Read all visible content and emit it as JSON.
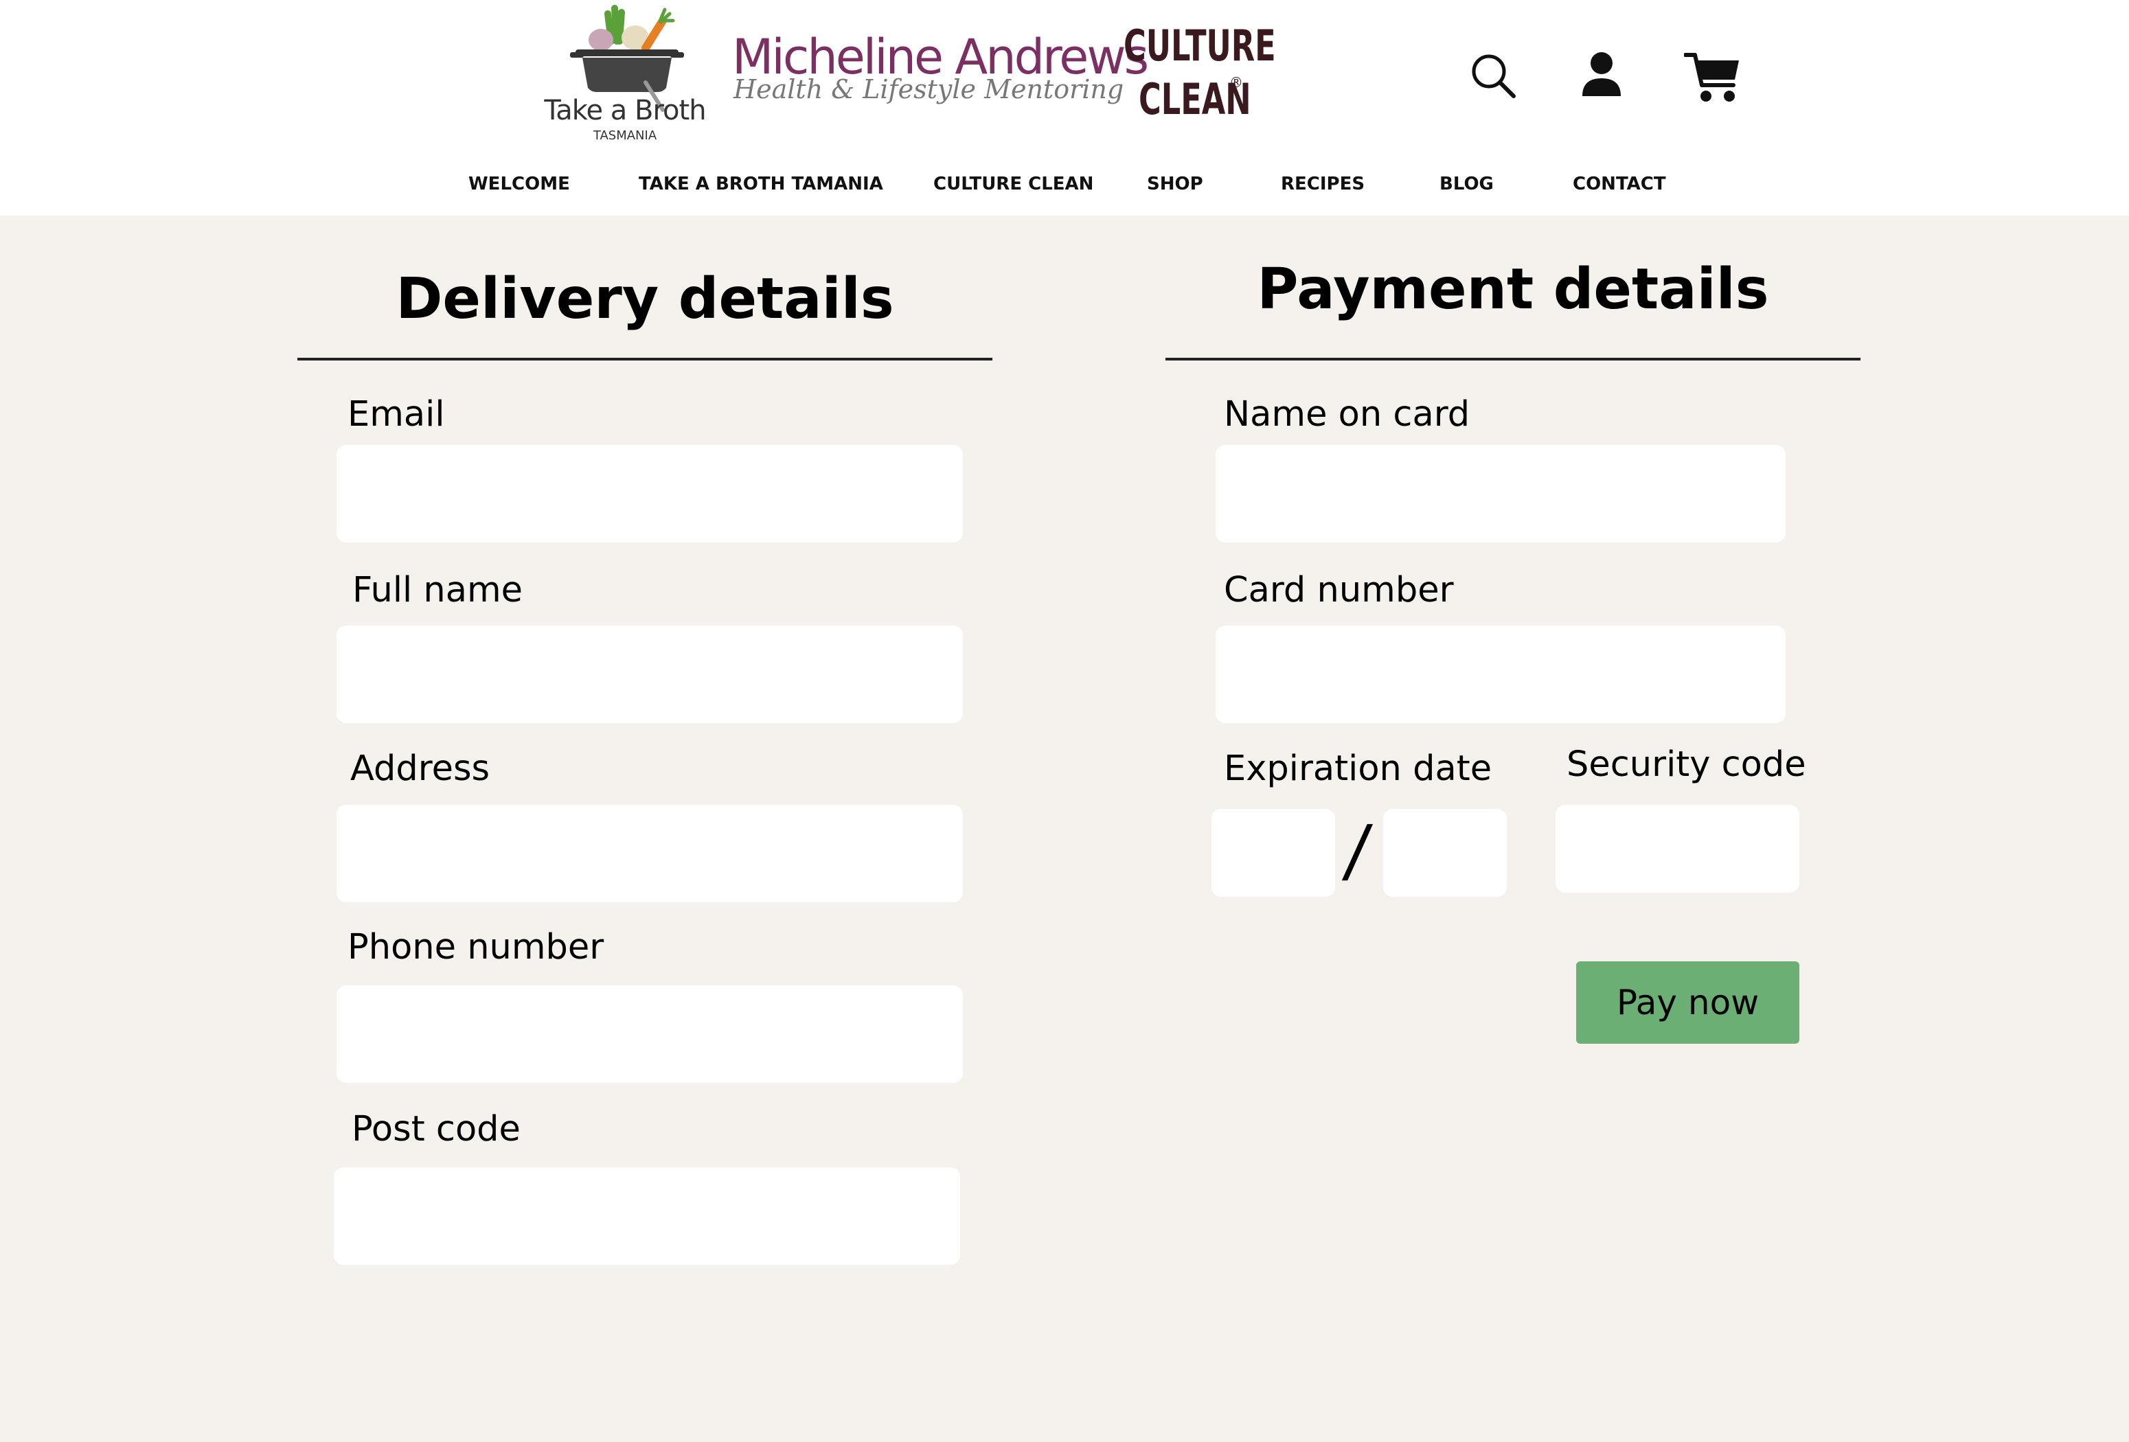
{
  "header": {
    "logo_broth": {
      "name": "Take a Broth",
      "sub": "TASMANIA"
    },
    "logo_mentoring": {
      "name": "Micheline Andrews",
      "tagline": "Health & Lifestyle Mentoring"
    },
    "logo_culture": {
      "line1": "CULTURE",
      "line2": "CLEAN",
      "mark": "®"
    },
    "icons": [
      "search-icon",
      "user-icon",
      "cart-icon"
    ]
  },
  "nav": {
    "welcome": "WELCOME",
    "broth": "TAKE A BROTH  TAMANIA",
    "culture": "CULTURE CLEAN",
    "shop": "SHOP",
    "recipes": "RECIPES",
    "blog": "BLOG",
    "contact": "CONTACT"
  },
  "delivery": {
    "title": "Delivery details",
    "email_label": "Email",
    "email_value": "",
    "fullname_label": "Full name",
    "fullname_value": "",
    "address_label": "Address",
    "address_value": "",
    "phone_label": "Phone number",
    "phone_value": "",
    "postcode_label": "Post code",
    "postcode_value": ""
  },
  "payment": {
    "title": "Payment details",
    "name_label": "Name on card",
    "name_value": "",
    "card_label": "Card number",
    "card_value": "",
    "expiry_label": "Expiration date",
    "expiry_month": "",
    "expiry_separator": "/",
    "expiry_year": "",
    "security_label": "Security code",
    "security_value": "",
    "pay_button": "Pay now"
  },
  "colors": {
    "page_background": "#f5f2ed",
    "header_background": "#ffffff",
    "brand_purple": "#7b2f63",
    "pay_button": "#6baf74"
  }
}
